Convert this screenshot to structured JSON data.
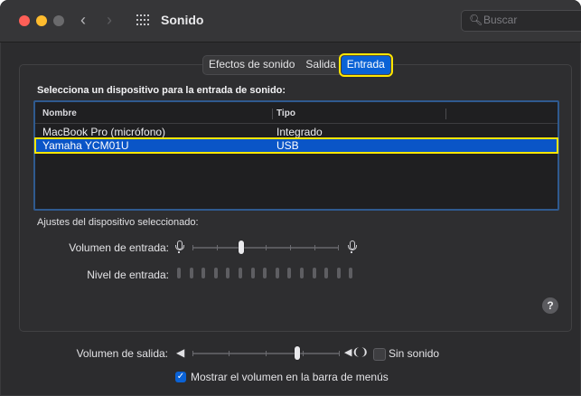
{
  "window": {
    "title": "Sonido"
  },
  "search": {
    "placeholder": "Buscar"
  },
  "tabs": [
    {
      "label": "Efectos de sonido"
    },
    {
      "label": "Salida"
    },
    {
      "label": "Entrada",
      "selected": true
    }
  ],
  "input_section": {
    "heading": "Selecciona un dispositivo para la entrada de sonido:",
    "columns": [
      "Nombre",
      "Tipo"
    ],
    "devices": [
      {
        "name": "MacBook Pro (micrófono)",
        "type": "Integrado",
        "selected": false
      },
      {
        "name": "Yamaha YCM01U",
        "type": "USB",
        "selected": true
      }
    ]
  },
  "device_settings": {
    "heading": "Ajustes del dispositivo seleccionado:",
    "input_volume_label": "Volumen de entrada:",
    "input_volume_level": 0.33,
    "input_level_label": "Nivel de entrada:",
    "input_level_bars_lit": 0
  },
  "output": {
    "volume_label": "Volumen de salida:",
    "volume_level": 0.72,
    "mute_label": "Sin sonido",
    "mute_checked": false,
    "menubar_label": "Mostrar el volumen en la barra de menús",
    "menubar_checked": true
  },
  "help": {
    "label": "?"
  },
  "colors": {
    "accent": "#0a62d6",
    "highlight": "#ffe600",
    "selection": "#0a55c7"
  }
}
